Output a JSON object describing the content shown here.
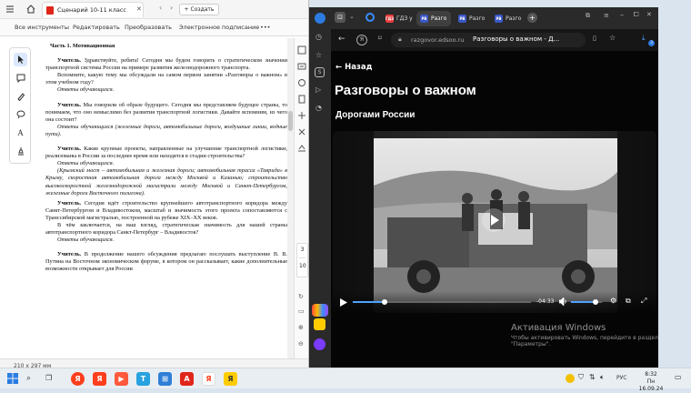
{
  "acrobat": {
    "tab_title": "Сценарий 10-11 класс",
    "create_label": "Создать",
    "menu": [
      "Все инструменты",
      "Редактировать",
      "Преобразовать",
      "Электронное подписание",
      "•••"
    ],
    "page_number": "3",
    "page_count": "10",
    "status_size": "210 x 297 мм",
    "doc": {
      "heading": "Часть 1. Мотивационная",
      "p1_speaker": "Учитель.",
      "p1_text": "Здравствуйте, ребята! Сегодня мы будем говорить о стратегическом значении транспортной системы России на примере развития железнодорожного транспорта.",
      "p2_text": "Вспомните, какую тему мы обсуждали на самом первом занятии «Разговоры о важном» в этом учебном году?",
      "answer1": "Ответы обучающихся.",
      "p3_speaker": "Учитель.",
      "p3_text": "Мы говорили об образе будущего. Сегодня мы представляем будущее страны, то понимаем, что оно немыслимо без развития транспортной логистики. Давайте вспомним, из чего она состоит?",
      "answer2": "Ответы обучающихся (железные дороги, автомобильные дороги, воздушные линии, водные пути).",
      "p4_speaker": "Учитель.",
      "p4_text": "Какие крупные проекты, направленные на улучшение транспортной логистики, реализованы в России за последнее время или находятся в стадии строительства?",
      "answer3": "Ответы обучающихся.",
      "answer3_detail": "(Крымский мост – автомобильная и железная дороги; автомобильная трасса «Таврида» в Крыму, скоростная автомобильная дорога между Москвой и Казанью; строительство высокоскоростной железнодорожной магистрали между Москвой и Санкт-Петербургом, железные дороги Восточного полигона).",
      "p5_speaker": "Учитель.",
      "p5_text": "Сегодня идёт строительство крупнейшего автотранспортного коридора между Санкт-Петербургом и Владивостоком, масштаб и значимость этого проекта сопоставляются с Транссибирской магистралью, построенной на рубеже XIX–XX веков.",
      "p6_text": "В чём заключается, на ваш взгляд, стратегическая значимость для нашей страны автотранспортного коридора Санкт-Петербург – Владивосток?",
      "answer4": "Ответы обучающихся.",
      "p7_speaker": "Учитель.",
      "p7_text": "В продолжение нашего обсуждения предлагаю послушать выступление В. В. Путина на Восточном экономическом форуме, в котором он рассказывает, какие дополнительные возможности открывает для России"
    }
  },
  "browser": {
    "tabs": [
      {
        "icon": "ГДЗ",
        "label": "ГДЗ у"
      },
      {
        "icon": "РВ",
        "label": "Разго"
      },
      {
        "icon": "РВ",
        "label": "Разго"
      },
      {
        "icon": "РВ",
        "label": "Разго"
      }
    ],
    "url_domain": "razgovor.edsoo.ru",
    "url_title": "Разговоры о важном - Д...",
    "back_label": "← Назад",
    "page_title": "Разговоры о важном",
    "subtitle": "Дорогами России",
    "video_time": "-04:33",
    "video_progress": 0.18,
    "volume_level": 0.8,
    "ext_badge": "3"
  },
  "watermark": {
    "title": "Активация Windows",
    "line1": "Чтобы активировать Windows, перейдите в раздел",
    "line2": "\"Параметры\"."
  },
  "taskbar": {
    "lang": "РУС",
    "time": "8:32",
    "date": "Пн 16.09.24",
    "apps": [
      "Я",
      "Я",
      "T",
      "⊞",
      "A",
      "Я",
      "Я"
    ]
  },
  "colors": {
    "yandex_red": "#fc3f1d",
    "accent_blue": "#4da3ff",
    "acrobat_red": "#e0261a"
  }
}
